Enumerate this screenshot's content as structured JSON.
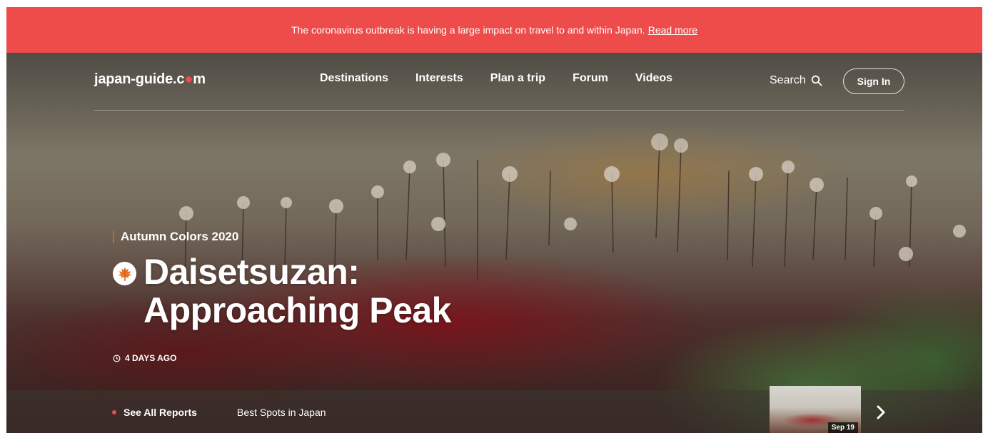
{
  "alert": {
    "message": "The coronavirus outbreak is having a large impact on travel to and within Japan.",
    "link_label": "Read more"
  },
  "header": {
    "logo_before": "japan-guide.c",
    "logo_dot": "●",
    "logo_after": "m",
    "nav": [
      "Destinations",
      "Interests",
      "Plan a trip",
      "Forum",
      "Videos"
    ],
    "search_label": "Search",
    "signin_label": "Sign In"
  },
  "hero": {
    "category": "Autumn Colors 2020",
    "headline_line1": "Daisetsuzan:",
    "headline_line2": "Approaching Peak",
    "badge_icon": "maple-leaf-icon",
    "time_icon": "clock-icon",
    "time_ago": "4 DAYS AGO"
  },
  "reports_bar": {
    "see_all_label": "See All Reports",
    "best_spots_label": "Best Spots in Japan",
    "thumb_date": "Sep 19",
    "next_icon": "chevron-right-icon"
  },
  "colors": {
    "accent": "#ee4b4b",
    "text_on_hero": "#ffffff"
  }
}
